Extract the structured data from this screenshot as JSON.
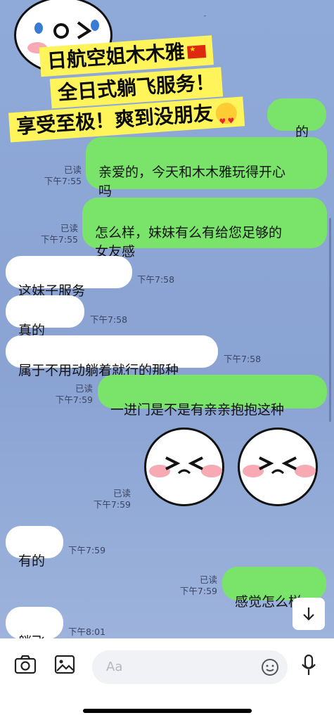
{
  "banner": {
    "line1": "日航空姐木木雅",
    "line2": "全日式躺飞服务！",
    "line3": "享受至极！爽到没朋友",
    "flag_icon": "china-flag-icon",
    "emoji_icon": "heart-eyes-emoji-icon"
  },
  "messages": [
    {
      "text": "的",
      "time": "",
      "read": ""
    },
    {
      "text": "亲爱的，今天和木木雅玩得开心\n吗",
      "read": "已读",
      "time": "下午7:55"
    },
    {
      "text": "怎么样，妹妹有么有给您足够的\n女友感",
      "read": "已读",
      "time": "下午7:55"
    },
    {
      "text": "这妹子服务",
      "time": "下午7:58"
    },
    {
      "text": "真的",
      "time": "下午7:58"
    },
    {
      "text": "属于不用动躺着就行的那种",
      "time": "下午7:58"
    },
    {
      "text": "一进门是不是有亲亲抱抱这种",
      "read": "已读",
      "time": "下午7:59"
    },
    {
      "read": "已读",
      "time": "下午7:59"
    },
    {
      "text": "有的",
      "time": "下午7:59"
    },
    {
      "text": "感觉怎么样",
      "read": "已读",
      "time": "下午7:59"
    },
    {
      "text": "躺飞",
      "time": "下午8:01"
    }
  ],
  "composer": {
    "placeholder": "Aa"
  },
  "colors": {
    "outgoing": "#79e36a",
    "incoming": "#ffffff",
    "background": "#8ea6d6"
  }
}
